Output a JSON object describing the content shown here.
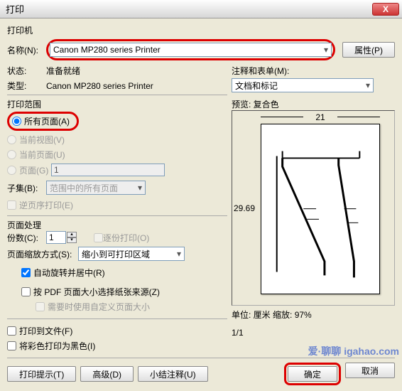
{
  "window": {
    "title": "打印",
    "close": "X"
  },
  "printer": {
    "section": "打印机",
    "name_label": "名称(N):",
    "name_value": "Canon MP280 series Printer",
    "properties_btn": "属性(P)",
    "status_label": "状态:",
    "status_value": "准备就绪",
    "type_label": "类型:",
    "type_value": "Canon MP280 series Printer",
    "comments_label": "注释和表单(M):",
    "comments_value": "文档和标记"
  },
  "range": {
    "section": "打印范围",
    "all_pages": "所有页面(A)",
    "current_view": "当前视图(V)",
    "current_page": "当前页面(U)",
    "pages_label": "页面(G)",
    "pages_value": "1",
    "subset_label": "子集(B):",
    "subset_value": "范围中的所有页面",
    "reverse": "逆页序打印(E)"
  },
  "page_handling": {
    "section": "页面处理",
    "copies_label": "份数(C):",
    "copies_value": "1",
    "collate": "逐份打印(O)",
    "scaling_label": "页面缩放方式(S):",
    "scaling_value": "缩小到可打印区域",
    "auto_rotate": "自动旋转并居中(R)",
    "choose_paper": "按 PDF 页面大小选择纸张来源(Z)",
    "custom_size": "需要时使用自定义页面大小"
  },
  "misc": {
    "print_to_file": "打印到文件(F)",
    "print_color_black": "将彩色打印为黑色(I)"
  },
  "preview": {
    "title": "预览: 复合色",
    "width": "21",
    "height": "29.69",
    "units": "单位: 厘米 缩放:",
    "zoom": "97%",
    "page_of": "1/1"
  },
  "buttons": {
    "print_tips": "打印提示(T)",
    "advanced": "高级(D)",
    "summary": "小结注释(U)",
    "ok": "确定",
    "cancel": "取消"
  },
  "watermark": "爱·聊聊 igahao.com"
}
